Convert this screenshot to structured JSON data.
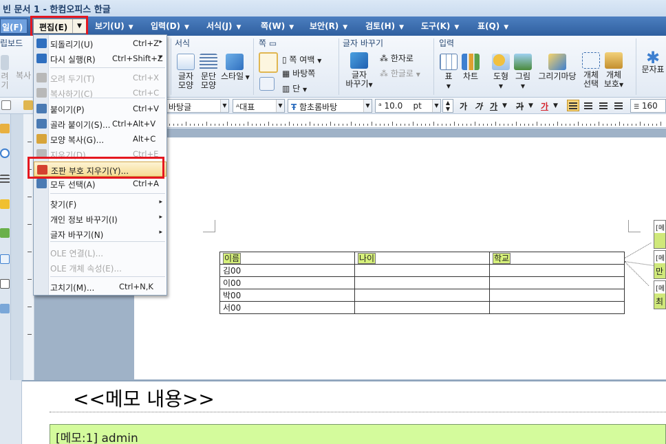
{
  "window": {
    "title": "빈 문서 1 - 한컴오피스 한글"
  },
  "menubar": {
    "file": "일(F)",
    "edit": "편집(E)",
    "items": [
      "보기(U)",
      "입력(D)",
      "서식(J)",
      "쪽(W)",
      "보안(R)",
      "검토(H)",
      "도구(K)",
      "표(Q)"
    ]
  },
  "ribbon": {
    "groups": {
      "clipboard": "립보드",
      "format": "서식",
      "page": "쪽",
      "change_chars": "글자 바꾸기",
      "input": "입력"
    },
    "buttons": {
      "cut_partial": "려",
      "cut_partial2": "기",
      "copy_partial": "복사",
      "char_shape": "글자\n모양",
      "para_shape": "문단\n모양",
      "style": "스타일",
      "page_margin": "쪽 여백",
      "background": "바탕쪽",
      "column": "단",
      "hanja": "한자로",
      "hangul": "한글로",
      "char_change": "글자\n바꾸기",
      "table": "표",
      "chart": "차트",
      "shape": "도형",
      "picture": "그림",
      "gallery": "그리기마당",
      "obj_select": "개체\n선택",
      "obj_protect": "개체\n보호",
      "text_art": "문자표"
    }
  },
  "format_bar": {
    "style": "바탕글",
    "lang": "대표",
    "font": "함초롬바탕",
    "size": "10.0",
    "unit": "pt",
    "bold": "가",
    "italic": "가",
    "underline": "가",
    "strike": "가",
    "color": "가",
    "line_spacing": "160"
  },
  "edit_menu": {
    "items": [
      {
        "label": "되돌리기(U)",
        "shortcut": "Ctrl+Z",
        "submenu": true,
        "disabled": false,
        "icon_color": "#2f6fbf"
      },
      {
        "label": "다시 실행(R)",
        "shortcut": "Ctrl+Shift+Z",
        "submenu": true,
        "disabled": false,
        "icon_color": "#2f6fbf"
      },
      {
        "label": "오려 두기(T)",
        "shortcut": "Ctrl+X",
        "submenu": false,
        "disabled": true,
        "icon_color": "#b8b8b8"
      },
      {
        "label": "복사하기(C)",
        "shortcut": "Ctrl+C",
        "submenu": false,
        "disabled": true,
        "icon_color": "#b8b8b8"
      },
      {
        "label": "붙이기(P)",
        "shortcut": "Ctrl+V",
        "submenu": false,
        "disabled": false,
        "icon_color": "#4a7ab3"
      },
      {
        "label": "골라 붙이기(S)...",
        "shortcut": "Ctrl+Alt+V",
        "submenu": false,
        "disabled": false,
        "icon_color": "#4a7ab3"
      },
      {
        "label": "모양 복사(G)...",
        "shortcut": "Alt+C",
        "submenu": false,
        "disabled": false,
        "icon_color": "#d7a43a"
      },
      {
        "label": "지우기(D)",
        "shortcut": "Ctrl+E",
        "submenu": false,
        "disabled": true,
        "icon_color": "#b8b8b8"
      },
      {
        "label": "조판 부호 지우기(Y)...",
        "shortcut": "",
        "submenu": false,
        "disabled": false,
        "highlighted": true,
        "icon_color": "#d4412f"
      },
      {
        "label": "모두 선택(A)",
        "shortcut": "Ctrl+A",
        "submenu": false,
        "disabled": false,
        "icon_color": "#4a7ab3"
      },
      {
        "label": "찾기(F)",
        "shortcut": "",
        "submenu": true,
        "disabled": false
      },
      {
        "label": "개인 정보 바꾸기(I)",
        "shortcut": "",
        "submenu": true,
        "disabled": false
      },
      {
        "label": "글자 바꾸기(N)",
        "shortcut": "",
        "submenu": true,
        "disabled": false
      },
      {
        "label": "OLE 연결(L)...",
        "shortcut": "",
        "submenu": false,
        "disabled": true
      },
      {
        "label": "OLE 개체 속성(E)...",
        "shortcut": "",
        "submenu": false,
        "disabled": true
      },
      {
        "label": "고치기(M)...",
        "shortcut": "Ctrl+N,K",
        "submenu": false,
        "disabled": false
      }
    ]
  },
  "document": {
    "table": {
      "headers": [
        "이름",
        "나이",
        "학교"
      ],
      "rows": [
        [
          "김00",
          "",
          ""
        ],
        [
          "이00",
          "",
          ""
        ],
        [
          "박00",
          "",
          ""
        ],
        [
          "서00",
          "",
          ""
        ]
      ]
    },
    "balloons": [
      {
        "header": "[메",
        "body": ""
      },
      {
        "header": "[메",
        "body": "만"
      },
      {
        "header": "[메",
        "body": "최"
      }
    ]
  },
  "memo_panel": {
    "title": "<<메모 내용>>",
    "item": "[메모:1] admin"
  },
  "colors": {
    "menubar": "#2f5f9f",
    "highlight_red": "#e5171f",
    "memo_green": "#d4fb9c",
    "field_green": "#d6f07a"
  }
}
